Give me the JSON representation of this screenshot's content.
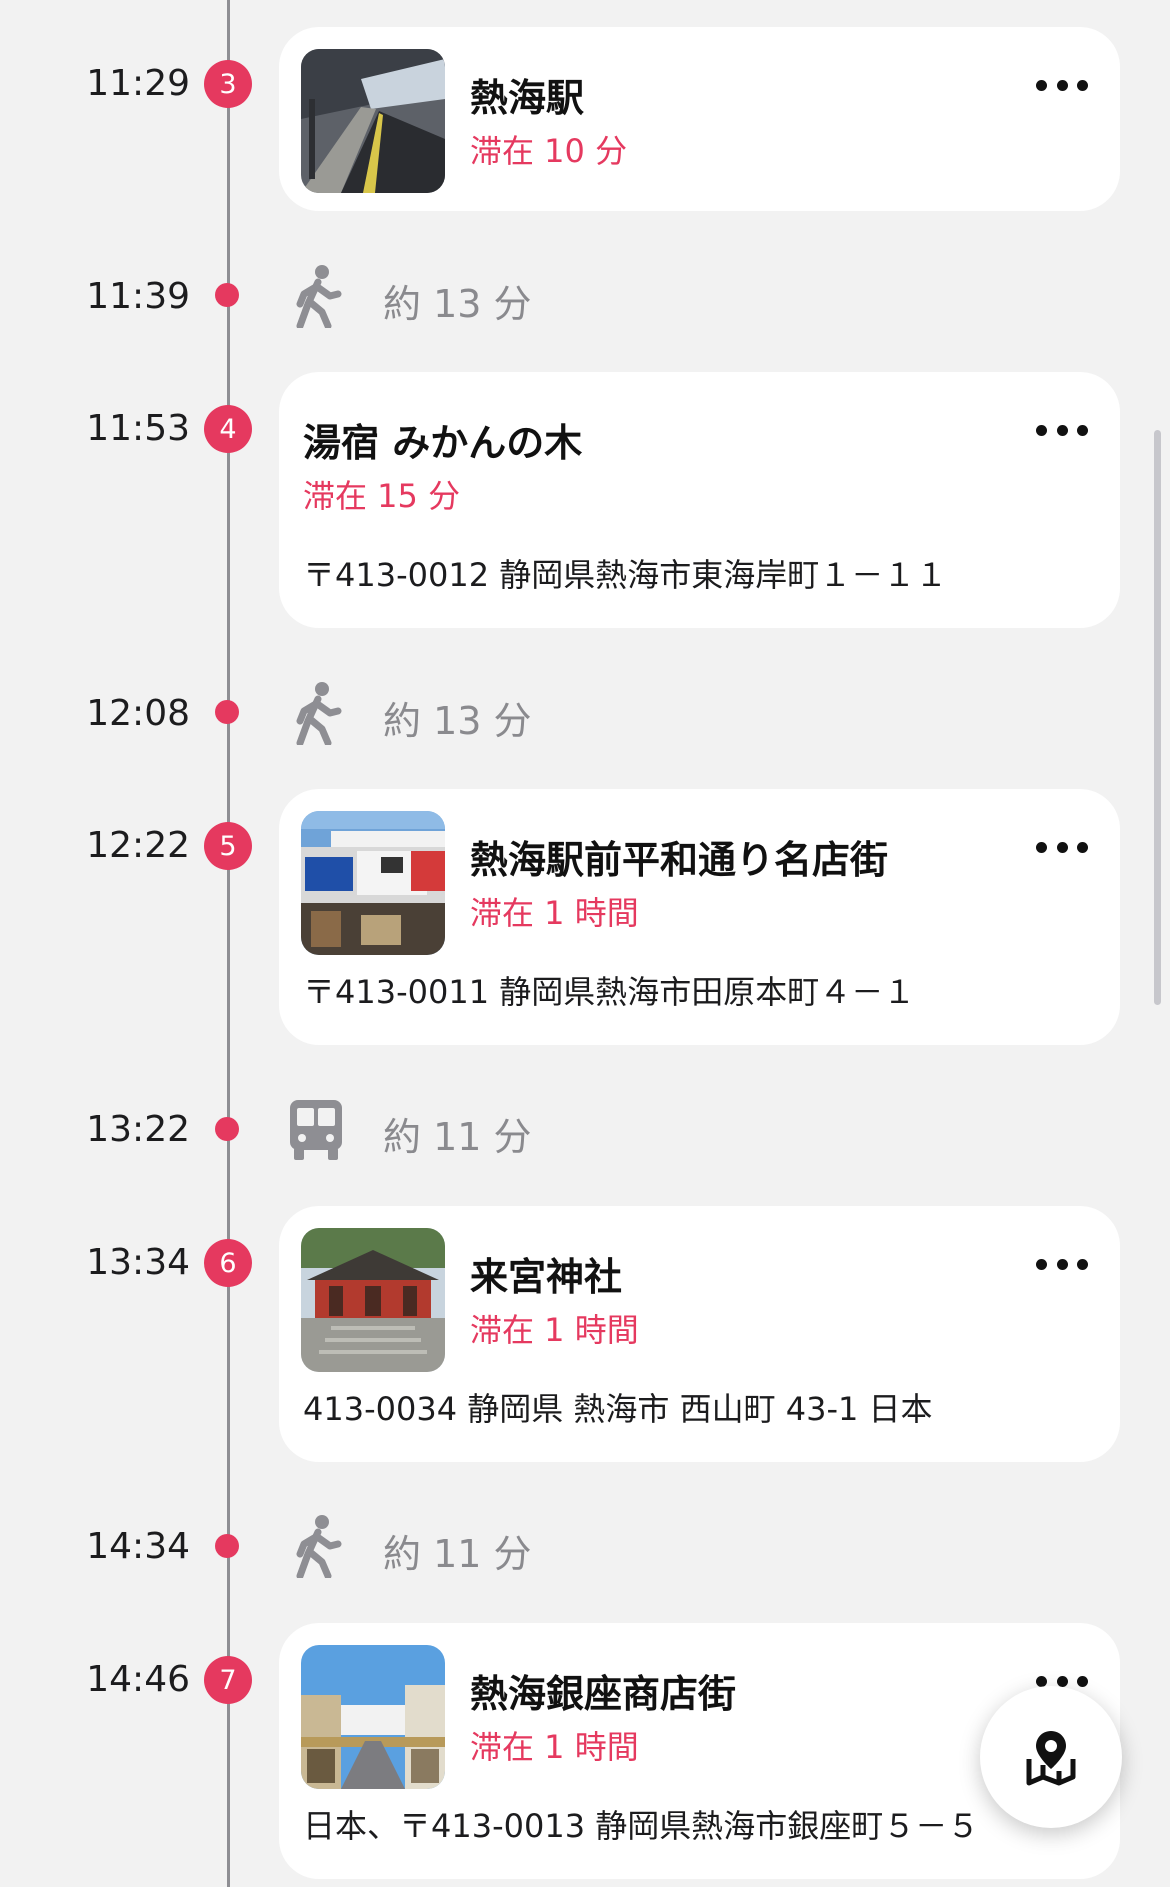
{
  "stops": [
    {
      "time": "11:29",
      "num": "3",
      "title": "熱海駅",
      "stay": "滞在 10 分",
      "address": ""
    },
    {
      "time": "11:53",
      "num": "4",
      "title": "湯宿 みかんの木",
      "stay": "滞在 15 分",
      "address": "〒413-0012 静岡県熱海市東海岸町１－１１"
    },
    {
      "time": "12:22",
      "num": "5",
      "title": "熱海駅前平和通り名店街",
      "stay": "滞在 1 時間",
      "address": "〒413-0011 静岡県熱海市田原本町４－１"
    },
    {
      "time": "13:34",
      "num": "6",
      "title": "来宮神社",
      "stay": "滞在 1 時間",
      "address": "413-0034 静岡県 熱海市 西山町 43-1 日本"
    },
    {
      "time": "14:46",
      "num": "7",
      "title": "熱海銀座商店街",
      "stay": "滞在 1 時間",
      "address": "日本、〒413-0013 静岡県熱海市銀座町５－５"
    }
  ],
  "transits": [
    {
      "time": "11:39",
      "mode": "walk-icon",
      "duration": "約 13 分"
    },
    {
      "time": "12:08",
      "mode": "walk-icon",
      "duration": "約 13 分"
    },
    {
      "time": "13:22",
      "mode": "bus-icon",
      "duration": "約 11 分"
    },
    {
      "time": "14:34",
      "mode": "walk-icon",
      "duration": "約 11 分"
    }
  ],
  "colors": {
    "accent": "#e5395f",
    "background": "#f2f2f2",
    "card": "#ffffff",
    "muted_text": "#8a8a8e"
  },
  "map_button": {
    "icon": "map-pin-icon"
  }
}
